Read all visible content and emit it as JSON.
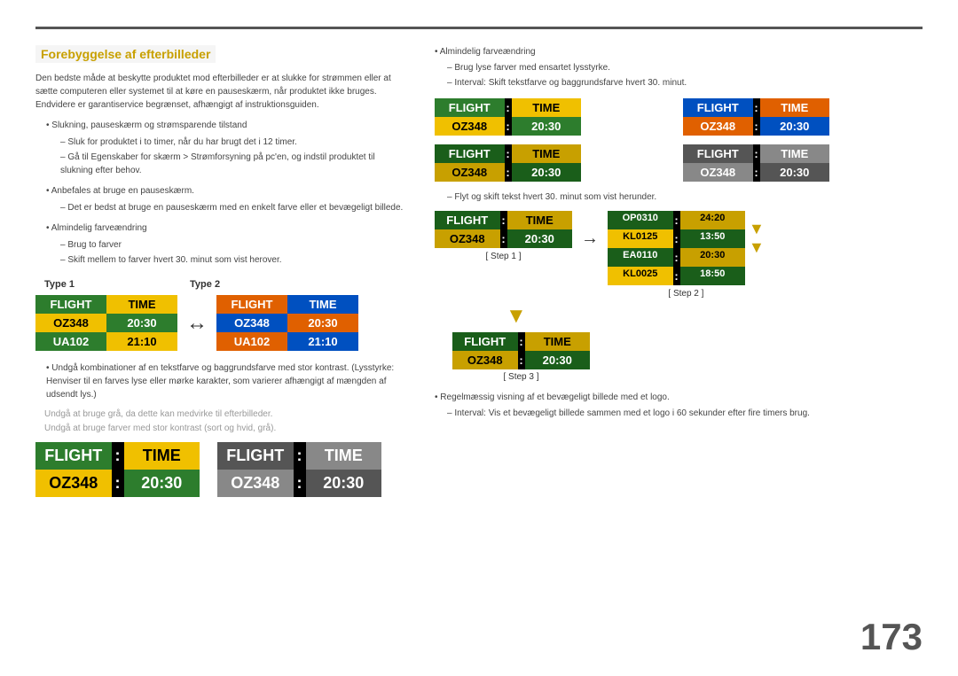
{
  "page": {
    "number": "173"
  },
  "section": {
    "title": "Forebyggelse af efterbilleder",
    "intro": "Den bedste måde at beskytte produktet mod efterbilleder er at slukke for strømmen eller at sætte computeren eller systemet til at køre en pauseskærm, når produktet ikke bruges. Endvidere er garantiservice begrænset, afhængigt af instruktionsguiden.",
    "bullets": [
      {
        "text": "Slukning, pauseskærm og strømsparende tilstand",
        "dashes": [
          "Sluk for produktet i to timer, når du har brugt det i 12 timer.",
          "Gå til Egenskaber for skærm > Strømforsyning på pc'en, og indstil produktet til slukning efter behov."
        ]
      },
      {
        "text": "Anbefales at bruge en pauseskærm.",
        "dashes": [
          "Det er bedst at bruge en pauseskærm med en enkelt farve eller et bevægeligt billede."
        ]
      },
      {
        "text": "Almindelig farveændring",
        "dashes": [
          "Brug to farver",
          "Skift mellem to farver hvert 30. minut som vist herover."
        ]
      }
    ],
    "type1_label": "Type 1",
    "type2_label": "Type 2",
    "boards": {
      "type1": {
        "header": [
          "FLIGHT",
          "TIME"
        ],
        "row1": [
          "OZ348",
          "20:30"
        ],
        "row2": [
          "UA102",
          "21:10"
        ]
      },
      "type2": {
        "header": [
          "FLIGHT",
          "TIME"
        ],
        "row1": [
          "OZ348",
          "20:30"
        ],
        "row2": [
          "UA102",
          "21:10"
        ]
      }
    },
    "avoid_bullets": [
      "Undgå kombinationer af en tekstfarve og baggrundsfarve med stor kontrast. (Lysstyrke: Henviser til en farves lyse eller mørke karakter, som varierer afhængigt af mængden af udsendt lys.)"
    ],
    "gray_texts": [
      "Undgå at bruge grå, da dette kan medvirke til efterbilleder.",
      "Undgå at bruge farver med stor kontrast (sort og hvid, grå)."
    ],
    "large_boards": {
      "board1": {
        "style": "dark",
        "header": [
          "FLIGHT",
          ":",
          "TIME"
        ],
        "row1": [
          "OZ348",
          ":",
          "20:30"
        ]
      },
      "board2": {
        "style": "gray",
        "header": [
          "FLIGHT",
          ":",
          "TIME"
        ],
        "row1": [
          "OZ348",
          ":",
          "20:30"
        ]
      }
    }
  },
  "right_section": {
    "bullet1": "Almindelig farveændring",
    "dash1": "Brug lyse farver med ensartet lysstyrke.",
    "dash2": "Interval: Skift tekstfarve og baggrundsfarve hvert 30. minut.",
    "color_boards": [
      {
        "id": "v1",
        "header": [
          "FLIGHT",
          ":",
          "TIME"
        ],
        "row1": [
          "OZ348",
          ":",
          "20:30"
        ]
      },
      {
        "id": "v2",
        "header": [
          "FLIGHT",
          ":",
          "TIME"
        ],
        "row1": [
          "OZ348",
          ":",
          "20:30"
        ]
      },
      {
        "id": "v3",
        "header": [
          "FLIGHT",
          ":",
          "TIME"
        ],
        "row1": [
          "OZ348",
          ":",
          "20:30"
        ]
      },
      {
        "id": "v4",
        "header": [
          "FLIGHT",
          ":",
          "TIME"
        ],
        "row1": [
          "OZ348",
          ":",
          "20:30"
        ]
      }
    ],
    "scroll_dash": "Flyt og skift tekst hvert 30. minut som vist herunder.",
    "step1_label": "[ Step 1 ]",
    "step2_label": "[ Step 2 ]",
    "step3_label": "[ Step 3 ]",
    "step1_board": {
      "header": [
        "FLIGHT",
        ":",
        "TIME"
      ],
      "row1": [
        "OZ348",
        ":",
        "20:30"
      ]
    },
    "step2_board": {
      "rows": [
        [
          "OP0310",
          ":",
          "24:20"
        ],
        [
          "KL0125",
          ":",
          "13:50"
        ],
        [
          "EA0110",
          ":",
          "20:30"
        ],
        [
          "KL0025",
          ":",
          "18:50"
        ]
      ]
    },
    "step3_board": {
      "header": [
        "FLIGHT",
        ":",
        "TIME"
      ],
      "row1": [
        "OZ348",
        ":",
        "20:30"
      ]
    },
    "final_bullet": "Regelmæssig visning af et bevægeligt billede med et logo.",
    "final_dash": "Interval: Vis et bevægeligt billede sammen med et logo i 60 sekunder efter fire timers brug."
  }
}
